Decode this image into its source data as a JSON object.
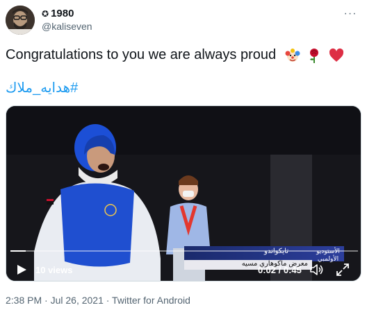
{
  "author": {
    "display_name": "1980",
    "handle": "@kaliseven",
    "more_label": "···"
  },
  "tweet": {
    "text": "Congratulations to you we are always proud",
    "emojis": [
      "clown-face-icon",
      "rose-icon",
      "red-heart-icon"
    ],
    "hashtag": "#هدايه_ملاك"
  },
  "video": {
    "views": "10 views",
    "time": "0:02 / 0:45",
    "progress": 0.044,
    "caption_line1": "تايكواندو",
    "caption_line2": "معرض ماكوهاري مسيه",
    "channel_name": "الأستوديو الأولمبي"
  },
  "meta": {
    "timestamp": "2:38 PM · Jul 26, 2021 · Twitter for Android"
  },
  "colors": {
    "link": "#1d9bf0",
    "secondary_text": "#536471",
    "heart": "#e0245e",
    "athlete_vest": "#1f4fd0",
    "helmet": "#1c4fd6"
  }
}
